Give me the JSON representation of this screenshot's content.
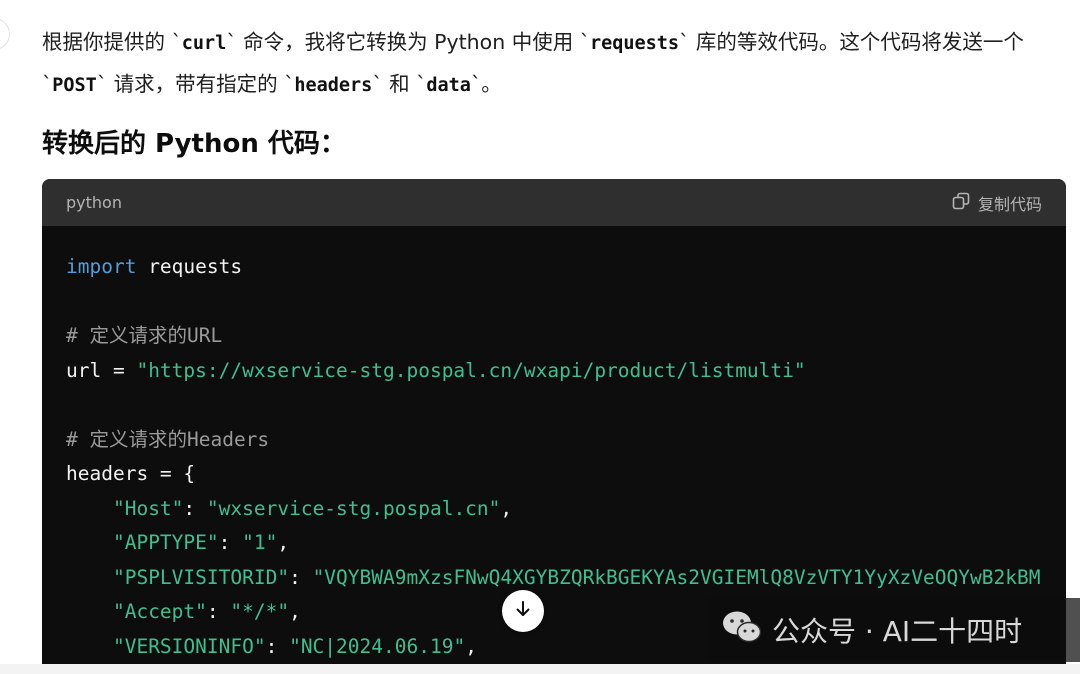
{
  "intro": {
    "t1": "根据你提供的 `",
    "c1": "curl",
    "t2": "` 命令，我将它转换为 Python 中使用 `",
    "c2": "requests",
    "t3": "` 库的等效代码。这个代码将发送一个 `",
    "c3": "POST",
    "t4": "` 请求，带有指定的 `",
    "c4": "headers",
    "t5": "` 和 `",
    "c5": "data",
    "t6": "`。"
  },
  "section_title": "转换后的 Python 代码：",
  "code_block": {
    "language": "python",
    "copy_label": "复制代码",
    "lines": {
      "l1_kw": "import",
      "l1_rest": " requests",
      "l3": "# 定义请求的URL",
      "l4_pre": "url = ",
      "l4_str": "\"https://wxservice-stg.pospal.cn/wxapi/product/listmulti\"",
      "l6": "# 定义请求的Headers",
      "l7": "headers = {",
      "l8_key": "\"Host\"",
      "l8_val": "\"wxservice-stg.pospal.cn\"",
      "l9_key": "\"APPTYPE\"",
      "l9_val": "\"1\"",
      "l10_key": "\"PSPLVISITORID\"",
      "l10_val": "\"VQYBWA9mXzsFNwQ4XGYBZQRkBGEKYAs2VGIEMlQ8VzVTY1YyXzVeOQYwB2kBM",
      "l11_key": "\"Accept\"",
      "l11_val": "\"*/*\"",
      "l12_key": "\"VERSIONINFO\"",
      "l12_val": "\"NC|2024.06.19\""
    }
  },
  "watermark": {
    "text": "公众号 · AI二十四时",
    "icon": "wechat-icon"
  },
  "icons": {
    "copy": "copy-icon",
    "scroll": "arrow-down-icon"
  },
  "colors": {
    "code_bg": "#0d0d0d",
    "code_header_bg": "#2f2f2f",
    "keyword": "#569cd6",
    "string": "#3fbf8f",
    "comment": "#9a9a9a"
  }
}
